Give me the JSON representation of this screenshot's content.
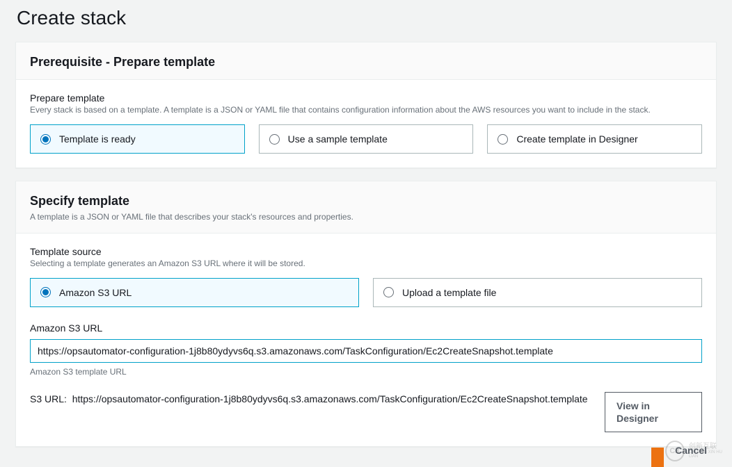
{
  "page": {
    "title": "Create stack"
  },
  "prereq": {
    "heading": "Prerequisite - Prepare template",
    "section_label": "Prepare template",
    "section_sub": "Every stack is based on a template. A template is a JSON or YAML file that contains configuration information about the AWS resources you want to include in the stack.",
    "options": [
      {
        "label": "Template is ready",
        "selected": true
      },
      {
        "label": "Use a sample template",
        "selected": false
      },
      {
        "label": "Create template in Designer",
        "selected": false
      }
    ]
  },
  "specify": {
    "heading": "Specify template",
    "sub": "A template is a JSON or YAML file that describes your stack's resources and properties.",
    "source_label": "Template source",
    "source_sub": "Selecting a template generates an Amazon S3 URL where it will be stored.",
    "options": [
      {
        "label": "Amazon S3 URL",
        "selected": true
      },
      {
        "label": "Upload a template file",
        "selected": false
      }
    ],
    "url_label": "Amazon S3 URL",
    "url_value": "https://opsautomator-configuration-1j8b80ydyvs6q.s3.amazonaws.com/TaskConfiguration/Ec2CreateSnapshot.template",
    "url_hint": "Amazon S3 template URL",
    "s3_prefix": "S3 URL:",
    "s3_value": "https://opsautomator-configuration-1j8b80ydyvs6q.s3.amazonaws.com/TaskConfiguration/Ec2CreateSnapshot.template",
    "view_designer_label": "View in Designer"
  },
  "footer": {
    "cancel": "Cancel"
  },
  "watermark": {
    "logo": "CX",
    "line1": "创新互联",
    "line2": "CHUANG XIN HU LIAN"
  }
}
